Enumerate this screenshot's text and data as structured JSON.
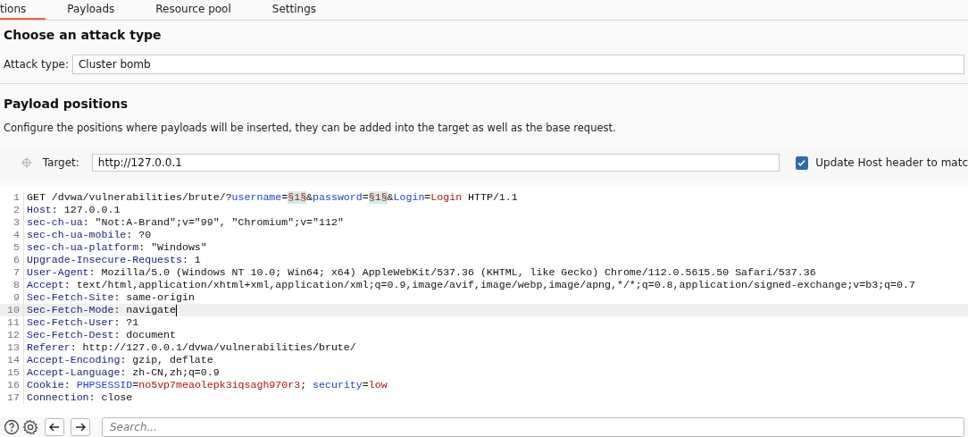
{
  "tabs": [
    {
      "label": "tions",
      "selected": true
    },
    {
      "label": "Payloads",
      "selected": false
    },
    {
      "label": "Resource pool",
      "selected": false
    },
    {
      "label": "Settings",
      "selected": false
    }
  ],
  "attack_section": {
    "title": "Choose an attack type",
    "label": "Attack type:",
    "value": "Cluster bomb"
  },
  "positions_section": {
    "title": "Payload positions",
    "description": "Configure the positions where payloads will be inserted, they can be added into the target as well as the base request.",
    "target_label": "Target:",
    "target_value": "http://127.0.0.1",
    "update_host": {
      "label": "Update Host header to matc",
      "checked": true
    }
  },
  "request_lines": [
    {
      "number": "1",
      "current": false,
      "segments": [
        {
          "kind": "plain",
          "text": "GET /dvwa/vulnerabilities/brute/?"
        },
        {
          "kind": "param",
          "text": "username"
        },
        {
          "kind": "plain",
          "text": "="
        },
        {
          "kind": "marker",
          "text": "§1§"
        },
        {
          "kind": "plain",
          "text": "&"
        },
        {
          "kind": "param",
          "text": "password"
        },
        {
          "kind": "plain",
          "text": "="
        },
        {
          "kind": "marker",
          "text": "§1§"
        },
        {
          "kind": "plain",
          "text": "&"
        },
        {
          "kind": "param",
          "text": "Login"
        },
        {
          "kind": "plain",
          "text": "="
        },
        {
          "kind": "value",
          "text": "Login"
        },
        {
          "kind": "plain",
          "text": " HTTP/1.1"
        }
      ]
    },
    {
      "number": "2",
      "current": false,
      "segments": [
        {
          "kind": "header",
          "text": "Host"
        },
        {
          "kind": "plain",
          "text": ": 127.0.0.1"
        }
      ]
    },
    {
      "number": "3",
      "current": false,
      "segments": [
        {
          "kind": "header",
          "text": "sec-ch-ua"
        },
        {
          "kind": "plain",
          "text": ": \"Not:A-Brand\";v=\"99\", \"Chromium\";v=\"112\""
        }
      ]
    },
    {
      "number": "4",
      "current": false,
      "segments": [
        {
          "kind": "header",
          "text": "sec-ch-ua-mobile"
        },
        {
          "kind": "plain",
          "text": ": ?0"
        }
      ]
    },
    {
      "number": "5",
      "current": false,
      "segments": [
        {
          "kind": "header",
          "text": "sec-ch-ua-platform"
        },
        {
          "kind": "plain",
          "text": ": \"Windows\""
        }
      ]
    },
    {
      "number": "6",
      "current": false,
      "segments": [
        {
          "kind": "header",
          "text": "Upgrade-Insecure-Requests"
        },
        {
          "kind": "plain",
          "text": ": 1"
        }
      ]
    },
    {
      "number": "7",
      "current": false,
      "segments": [
        {
          "kind": "header",
          "text": "User-Agent"
        },
        {
          "kind": "plain",
          "text": ": Mozilla/5.0 (Windows NT 10.0; Win64; x64) AppleWebKit/537.36 (KHTML, like Gecko) Chrome/112.0.5615.50 Safari/537.36"
        }
      ]
    },
    {
      "number": "8",
      "current": false,
      "segments": [
        {
          "kind": "header",
          "text": "Accept"
        },
        {
          "kind": "plain",
          "text": ": text/html,application/xhtml+xml,application/xml;q=0.9,image/avif,image/webp,image/apng,*/*;q=0.8,application/signed-exchange;v=b3;q=0.7"
        }
      ]
    },
    {
      "number": "9",
      "current": false,
      "segments": [
        {
          "kind": "header",
          "text": "Sec-Fetch-Site"
        },
        {
          "kind": "plain",
          "text": ": same-origin"
        }
      ]
    },
    {
      "number": "10",
      "current": true,
      "segments": [
        {
          "kind": "header",
          "text": "Sec-Fetch-Mode"
        },
        {
          "kind": "plain",
          "text": ": navigate"
        }
      ]
    },
    {
      "number": "11",
      "current": false,
      "segments": [
        {
          "kind": "header",
          "text": "Sec-Fetch-User"
        },
        {
          "kind": "plain",
          "text": ": ?1"
        }
      ]
    },
    {
      "number": "12",
      "current": false,
      "segments": [
        {
          "kind": "header",
          "text": "Sec-Fetch-Dest"
        },
        {
          "kind": "plain",
          "text": ": document"
        }
      ]
    },
    {
      "number": "13",
      "current": false,
      "segments": [
        {
          "kind": "header",
          "text": "Referer"
        },
        {
          "kind": "plain",
          "text": ": http://127.0.0.1/dvwa/vulnerabilities/brute/"
        }
      ]
    },
    {
      "number": "14",
      "current": false,
      "segments": [
        {
          "kind": "header",
          "text": "Accept-Encoding"
        },
        {
          "kind": "plain",
          "text": ": gzip, deflate"
        }
      ]
    },
    {
      "number": "15",
      "current": false,
      "segments": [
        {
          "kind": "header",
          "text": "Accept-Language"
        },
        {
          "kind": "plain",
          "text": ": zh-CN,zh;q=0.9"
        }
      ]
    },
    {
      "number": "16",
      "current": false,
      "segments": [
        {
          "kind": "header",
          "text": "Cookie"
        },
        {
          "kind": "plain",
          "text": ": "
        },
        {
          "kind": "param",
          "text": "PHPSESSID"
        },
        {
          "kind": "plain",
          "text": "="
        },
        {
          "kind": "value",
          "text": "no5vp7meaolepk3iqsagh970r3"
        },
        {
          "kind": "plain",
          "text": "; "
        },
        {
          "kind": "param",
          "text": "security"
        },
        {
          "kind": "plain",
          "text": "="
        },
        {
          "kind": "value",
          "text": "low"
        }
      ]
    },
    {
      "number": "17",
      "current": false,
      "segments": [
        {
          "kind": "header",
          "text": "Connection"
        },
        {
          "kind": "plain",
          "text": ": close"
        }
      ]
    }
  ],
  "bottom_bar": {
    "search_placeholder": "Search..."
  }
}
